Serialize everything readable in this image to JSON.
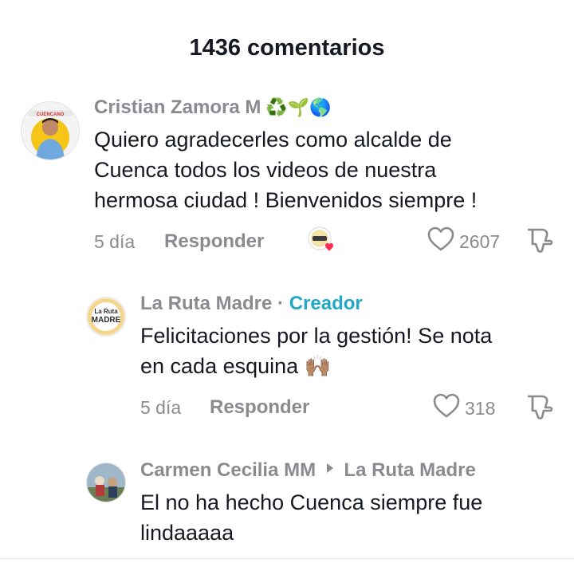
{
  "header": {
    "title": "1436 comentarios"
  },
  "comments": [
    {
      "username": "Cristian Zamora M",
      "username_emojis": "♻️🌱🌎",
      "text": "Quiero agradecerles como alcalde de Cuenca todos los videos de nuestra hermosa ciudad ! Bienvenidos siempre !",
      "lines": [
        "Quiero agradecerles como alcalde de",
        "Cuenca todos los videos de nuestra",
        "hermosa ciudad ! Bienvenidos siempre !"
      ],
      "time": "5 día",
      "reply_label": "Responder",
      "likes": "2607",
      "liked_by_creator": true,
      "avatar_text": "CUENCANO"
    },
    {
      "username": "La Ruta Madre",
      "separator": "·",
      "badge": "Creador",
      "lines": [
        "Felicitaciones por la gestión! Se nota",
        "en cada esquina 🙌🏽"
      ],
      "line2_text": "en cada esquina",
      "line2_emoji": "🙌🏽",
      "time": "5 día",
      "reply_label": "Responder",
      "likes": "318",
      "avatar_text_1": "La Ruta",
      "avatar_text_2": "MADRE"
    },
    {
      "username": "Carmen Cecilia MM",
      "reply_to": "La Ruta Madre",
      "lines": [
        "El no ha hecho Cuenca siempre fue",
        "lindaaaaa"
      ]
    }
  ],
  "colors": {
    "secondary_text": "#8a8b91",
    "creator_badge": "#22a7c9",
    "primary_text": "#161823",
    "like_heart_red": "#fe2c55"
  }
}
